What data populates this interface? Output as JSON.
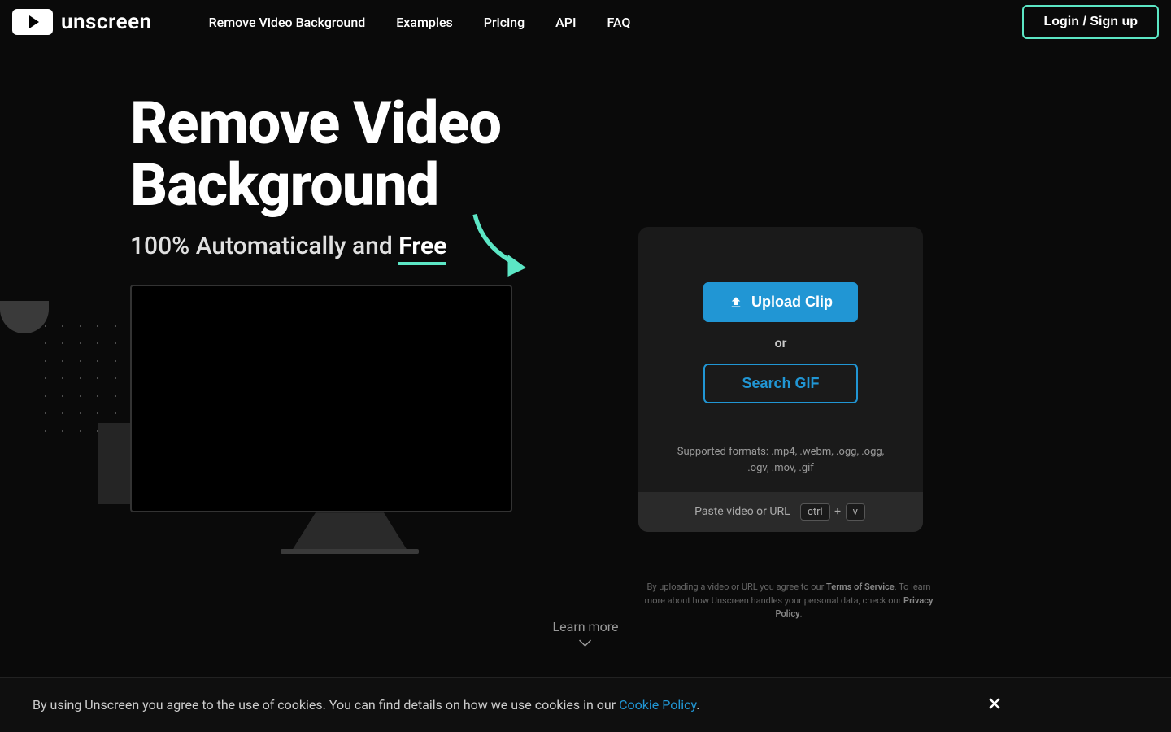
{
  "brand": {
    "name": "unscreen"
  },
  "nav": {
    "items": [
      {
        "label": "Remove Video Background"
      },
      {
        "label": "Examples"
      },
      {
        "label": "Pricing"
      },
      {
        "label": "API"
      },
      {
        "label": "FAQ"
      }
    ]
  },
  "header": {
    "login_label": "Login / Sign up"
  },
  "hero": {
    "title_line1": "Remove Video",
    "title_line2": "Background",
    "subtitle_prefix": "100% Automatically and ",
    "subtitle_free": "Free"
  },
  "upload": {
    "button_label": "Upload Clip",
    "or_label": "or",
    "search_gif_label": "Search GIF",
    "supported_label": "Supported formats: .mp4, .webm, .ogg, .ogg, .ogv, .mov, .gif",
    "paste_prefix": "Paste video or ",
    "paste_url": "URL",
    "kbd1": "ctrl",
    "kbd_plus": " + ",
    "kbd2": "v"
  },
  "disclaimer": {
    "prefix": "By uploading a video or URL you agree to our ",
    "terms": "Terms of Service",
    "middle": ". To learn more about how Unscreen handles your personal data, check our ",
    "privacy": "Privacy Policy",
    "suffix": "."
  },
  "learn_more": {
    "label": "Learn more"
  },
  "cookie": {
    "prefix": "By using Unscreen you agree to the use of cookies. You can find details on how we use cookies in our ",
    "link": "Cookie Policy",
    "suffix": "."
  }
}
